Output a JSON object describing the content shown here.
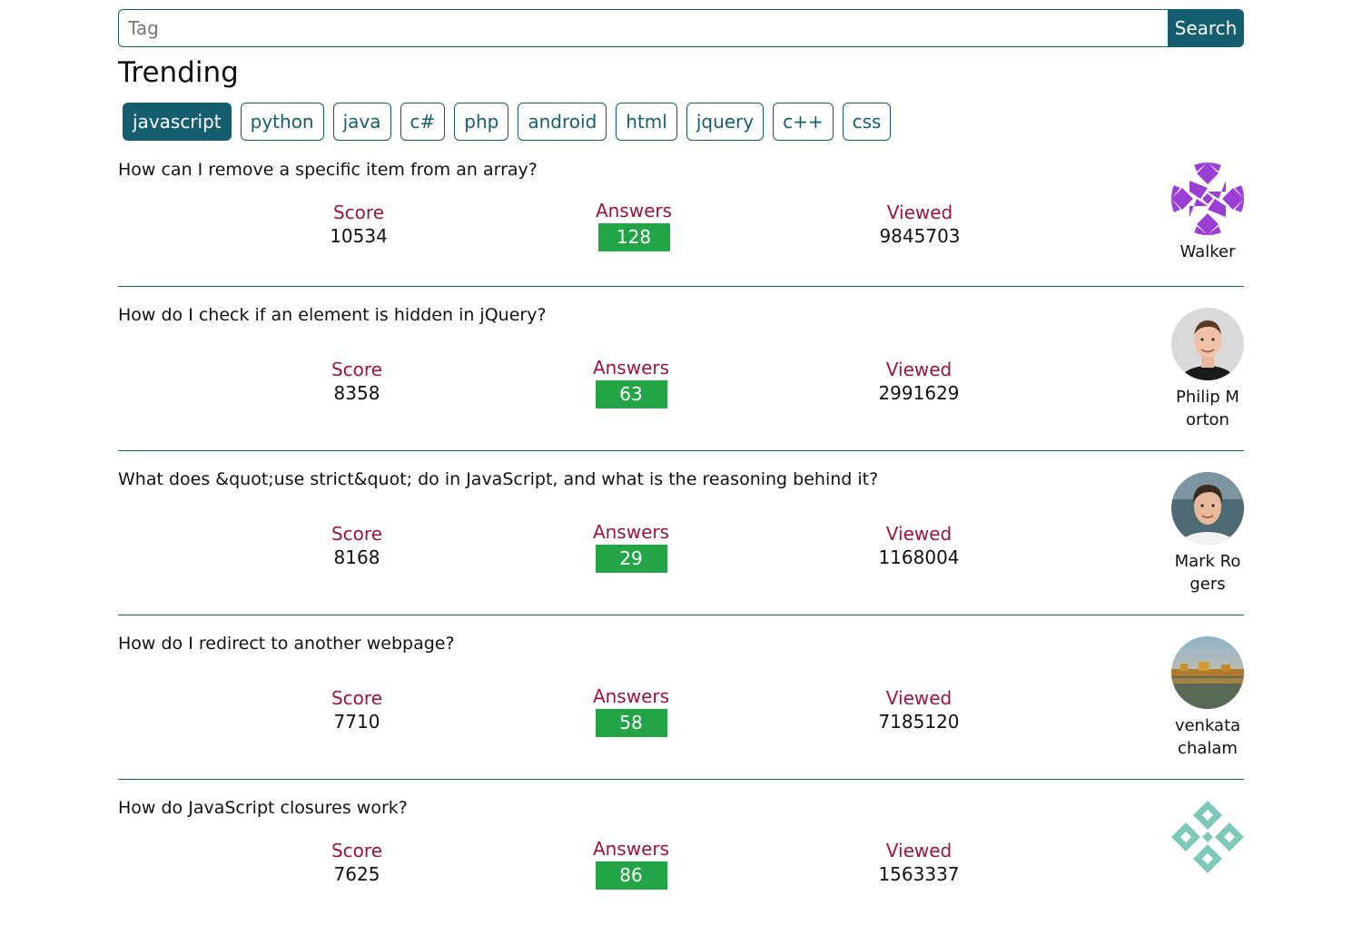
{
  "search": {
    "placeholder": "Tag",
    "value": "",
    "button_label": "Search"
  },
  "trending": {
    "title": "Trending",
    "tags": [
      {
        "label": "javascript",
        "active": true
      },
      {
        "label": "python",
        "active": false
      },
      {
        "label": "java",
        "active": false
      },
      {
        "label": "c#",
        "active": false
      },
      {
        "label": "php",
        "active": false
      },
      {
        "label": "android",
        "active": false
      },
      {
        "label": "html",
        "active": false
      },
      {
        "label": "jquery",
        "active": false
      },
      {
        "label": "c++",
        "active": false
      },
      {
        "label": "css",
        "active": false
      }
    ]
  },
  "labels": {
    "score": "Score",
    "answers": "Answers",
    "viewed": "Viewed"
  },
  "questions": [
    {
      "title": "How can I remove a specific item from an array?",
      "score": "10534",
      "answers": "128",
      "viewed": "9845703",
      "user": "Walker",
      "avatar": "identicon-purple"
    },
    {
      "title": "How do I check if an element is hidden in jQuery?",
      "score": "8358",
      "answers": "63",
      "viewed": "2991629",
      "user": "Philip Morton",
      "avatar": "photo-man-light"
    },
    {
      "title": "What does &quot;use strict&quot; do in JavaScript, and what is the reasoning behind it?",
      "score": "8168",
      "answers": "29",
      "viewed": "1168004",
      "user": "Mark Rogers",
      "avatar": "photo-man-dark"
    },
    {
      "title": "How do I redirect to another webpage?",
      "score": "7710",
      "answers": "58",
      "viewed": "7185120",
      "user": "venkatachalam",
      "avatar": "photo-landscape"
    },
    {
      "title": "How do JavaScript closures work?",
      "score": "7625",
      "answers": "86",
      "viewed": "1563337",
      "user": "",
      "avatar": "identicon-teal"
    }
  ],
  "colors": {
    "primary": "#155e70",
    "label": "#9b1340",
    "answers_badge": "#22a447"
  }
}
